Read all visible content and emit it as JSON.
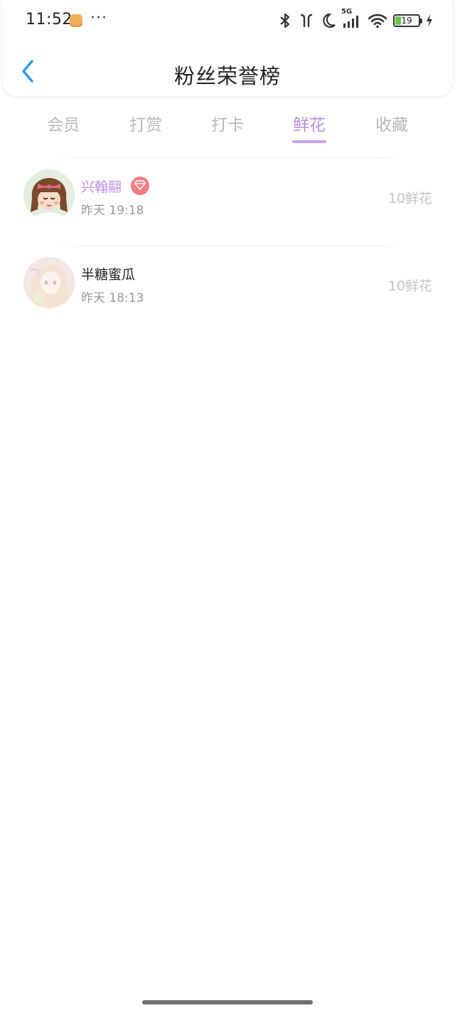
{
  "status_bar": {
    "time": "11:52",
    "dots": "···",
    "network": "5G",
    "battery_level": "19",
    "battery_color": "#6cc04a"
  },
  "header": {
    "title": "粉丝荣誉榜",
    "back_icon": "chevron-left-icon",
    "accent_color": "#2b9be6"
  },
  "tabs": [
    {
      "label": "会员",
      "active": false
    },
    {
      "label": "打赏",
      "active": false
    },
    {
      "label": "打卡",
      "active": false
    },
    {
      "label": "鲜花",
      "active": true
    },
    {
      "label": "收藏",
      "active": false
    }
  ],
  "tab_active_color": "#b98be0",
  "list": [
    {
      "name": "兴翰翮",
      "name_color": "#b98be0",
      "has_vip_badge": true,
      "badge_icon": "diamond-icon",
      "time": "昨天 19:18",
      "amount": "10鲜花"
    },
    {
      "name": "半糖蜜瓜",
      "name_color": "#222222",
      "has_vip_badge": false,
      "time": "昨天 18:13",
      "amount": "10鲜花"
    }
  ]
}
